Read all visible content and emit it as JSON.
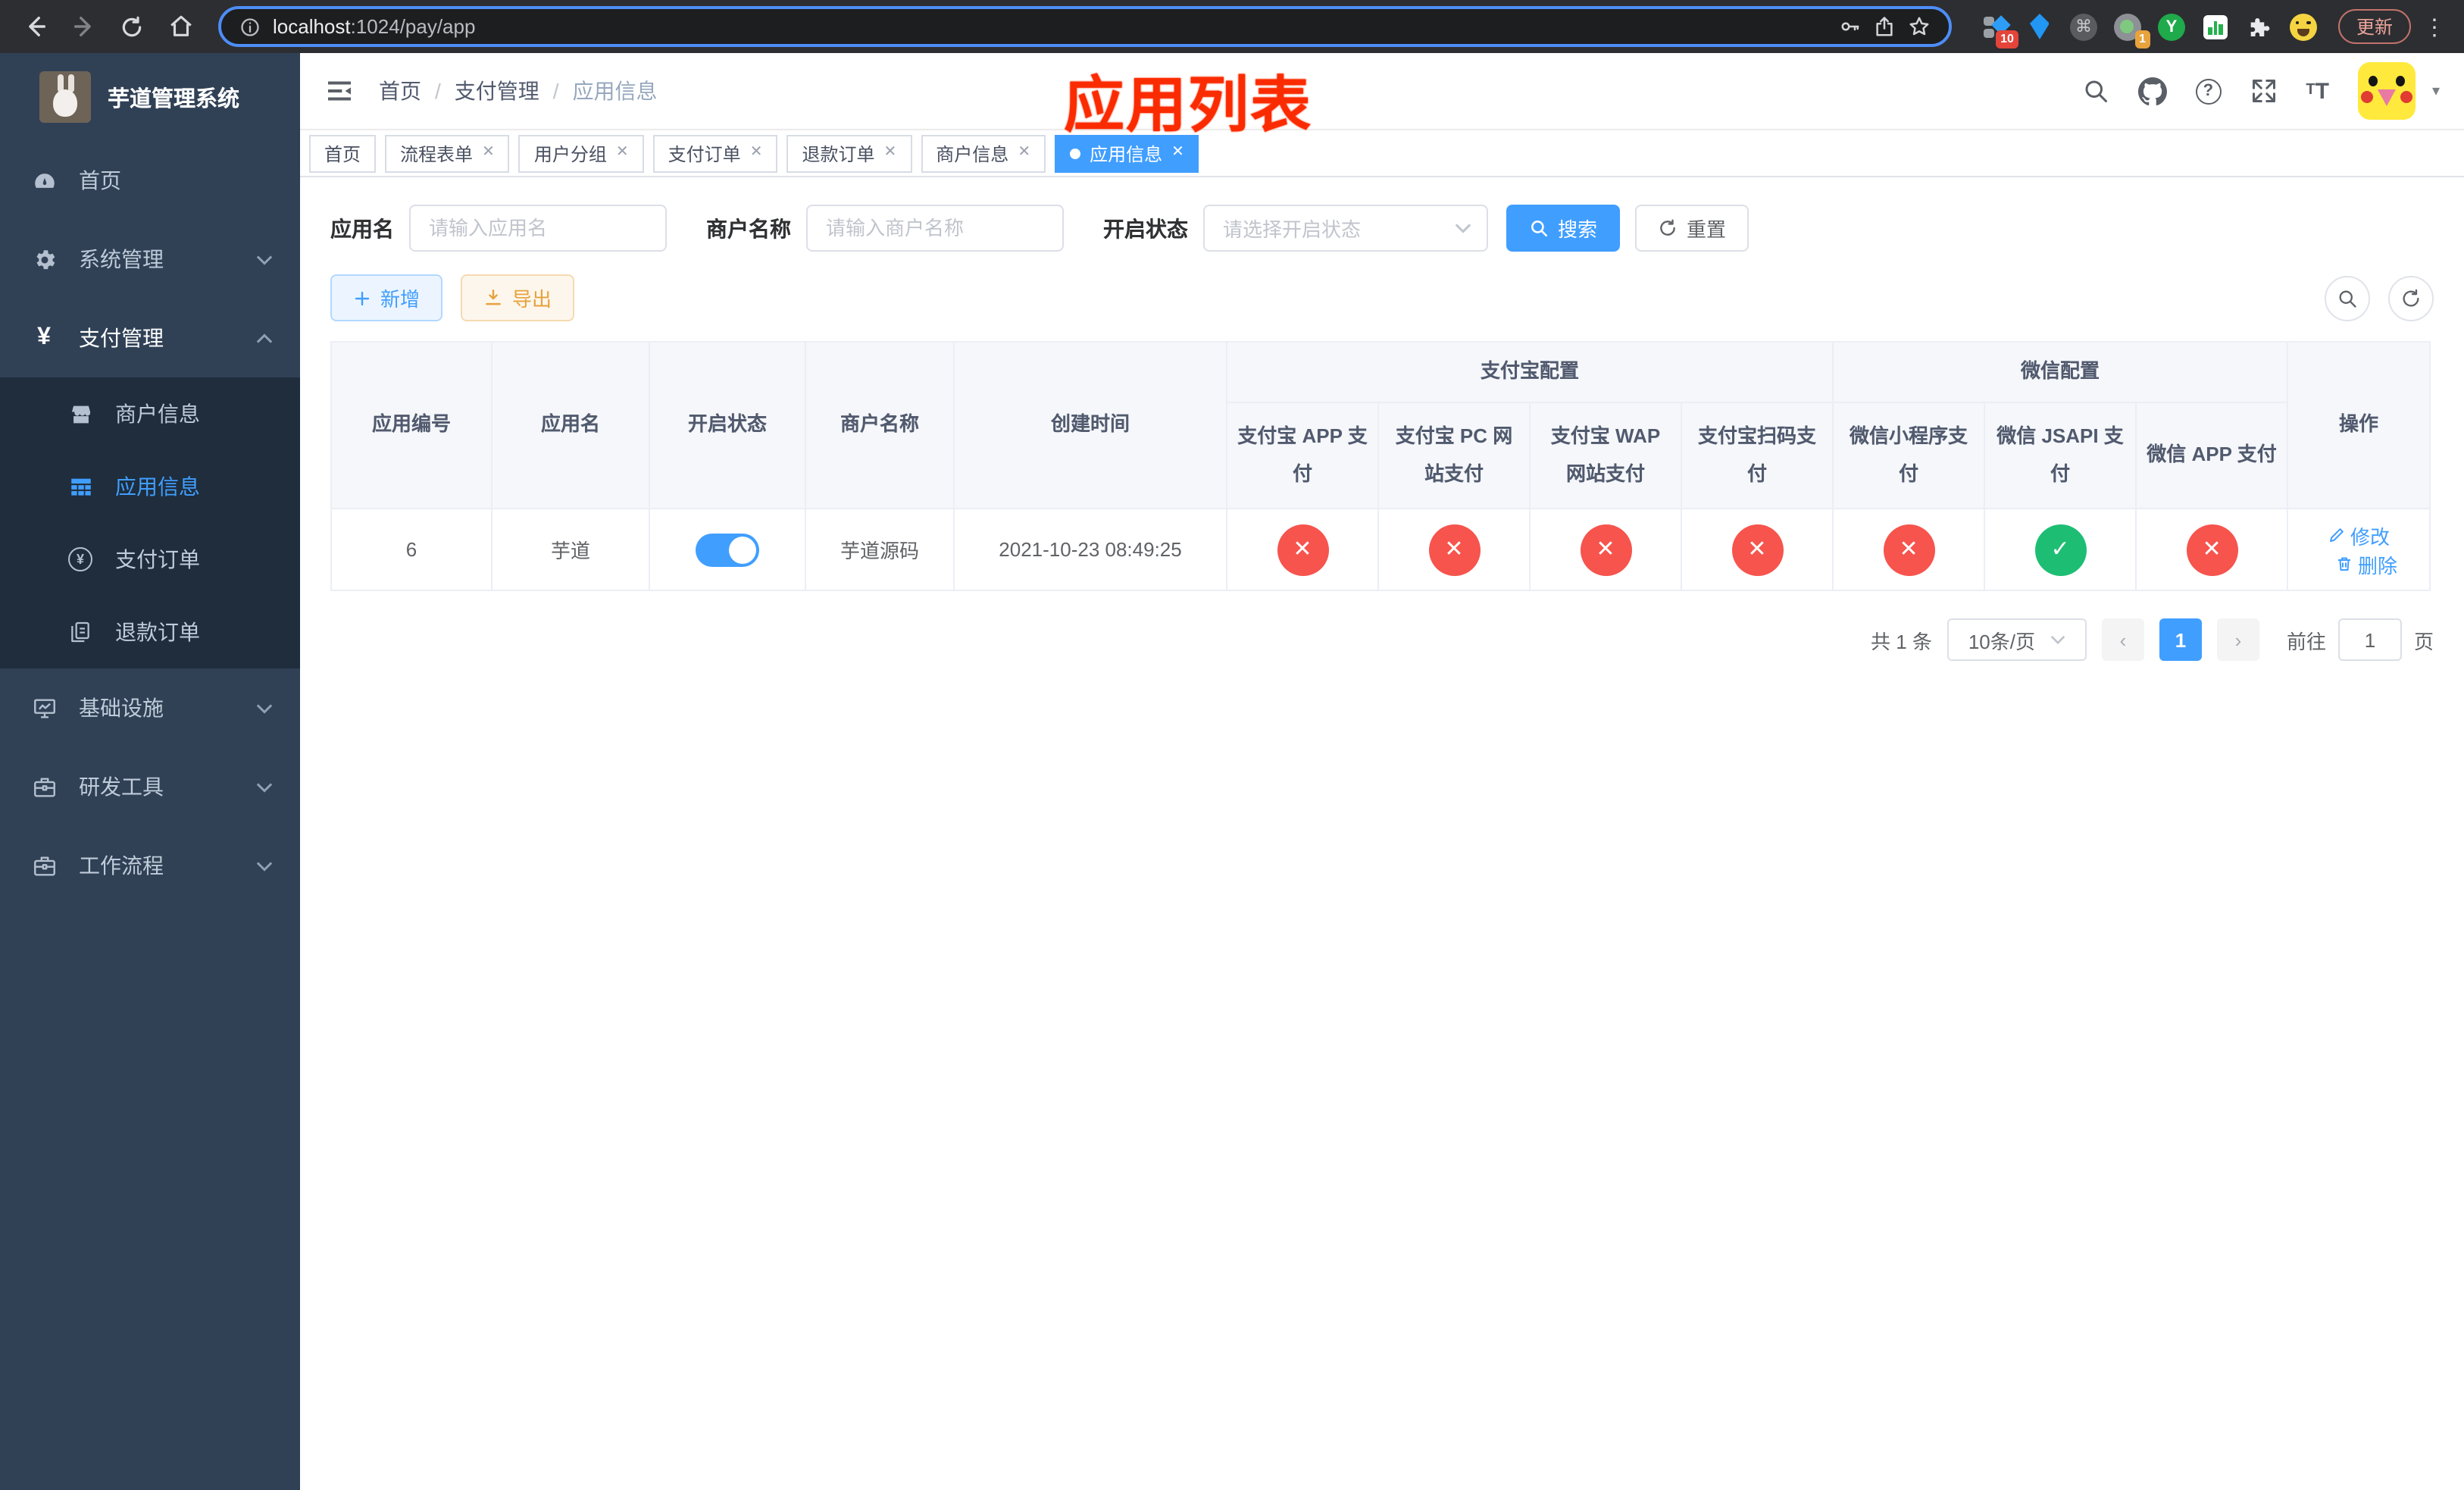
{
  "browser": {
    "url_host": "localhost",
    "url_rest": ":1024/pay/app",
    "update_label": "更新",
    "ext_badge_blue_diamond": "10",
    "ext_badge_profile": "1"
  },
  "sidebar": {
    "title": "芋道管理系统",
    "items": [
      {
        "label": "首页"
      },
      {
        "label": "系统管理"
      },
      {
        "label": "支付管理"
      },
      {
        "label": "商户信息"
      },
      {
        "label": "应用信息"
      },
      {
        "label": "支付订单"
      },
      {
        "label": "退款订单"
      },
      {
        "label": "基础设施"
      },
      {
        "label": "研发工具"
      },
      {
        "label": "工作流程"
      }
    ]
  },
  "header": {
    "breadcrumb": [
      "首页",
      "支付管理",
      "应用信息"
    ],
    "annotation": "应用列表"
  },
  "tabs": [
    {
      "label": "首页"
    },
    {
      "label": "流程表单"
    },
    {
      "label": "用户分组"
    },
    {
      "label": "支付订单"
    },
    {
      "label": "退款订单"
    },
    {
      "label": "商户信息"
    },
    {
      "label": "应用信息"
    }
  ],
  "filters": {
    "app_name_label": "应用名",
    "app_name_placeholder": "请输入应用名",
    "merchant_label": "商户名称",
    "merchant_placeholder": "请输入商户名称",
    "status_label": "开启状态",
    "status_placeholder": "请选择开启状态",
    "search_button": "搜索",
    "reset_button": "重置"
  },
  "toolbar": {
    "add_button": "新增",
    "export_button": "导出"
  },
  "table": {
    "group_alipay": "支付宝配置",
    "group_wechat": "微信配置",
    "columns": {
      "app_id": "应用编号",
      "app_name": "应用名",
      "status": "开启状态",
      "merchant": "商户名称",
      "created": "创建时间",
      "alipay_app": "支付宝 APP 支付",
      "alipay_pc": "支付宝 PC 网站支付",
      "alipay_wap": "支付宝 WAP 网站支付",
      "alipay_qr": "支付宝扫码支付",
      "wx_lite": "微信小程序支付",
      "wx_jsapi": "微信 JSAPI 支付",
      "wx_app": "微信 APP 支付",
      "actions": "操作"
    },
    "row": {
      "app_id": "6",
      "app_name": "芋道",
      "enabled": true,
      "merchant": "芋道源码",
      "created": "2021-10-23 08:49:25",
      "pay_statuses": [
        false,
        false,
        false,
        false,
        false,
        true,
        false
      ],
      "edit": "修改",
      "delete": "删除"
    }
  },
  "pagination": {
    "total": "共 1 条",
    "page_size": "10条/页",
    "page": "1",
    "goto_prefix": "前往",
    "goto_value": "1",
    "goto_suffix": "页"
  },
  "colors": {
    "accent": "#409eff",
    "sidebar_bg": "#304156",
    "submenu_bg": "#1f2d3d",
    "status_on": "#1dbe74",
    "status_off": "#f6544d",
    "warn": "#e6a23c",
    "annotation_red": "#fb2b00"
  }
}
